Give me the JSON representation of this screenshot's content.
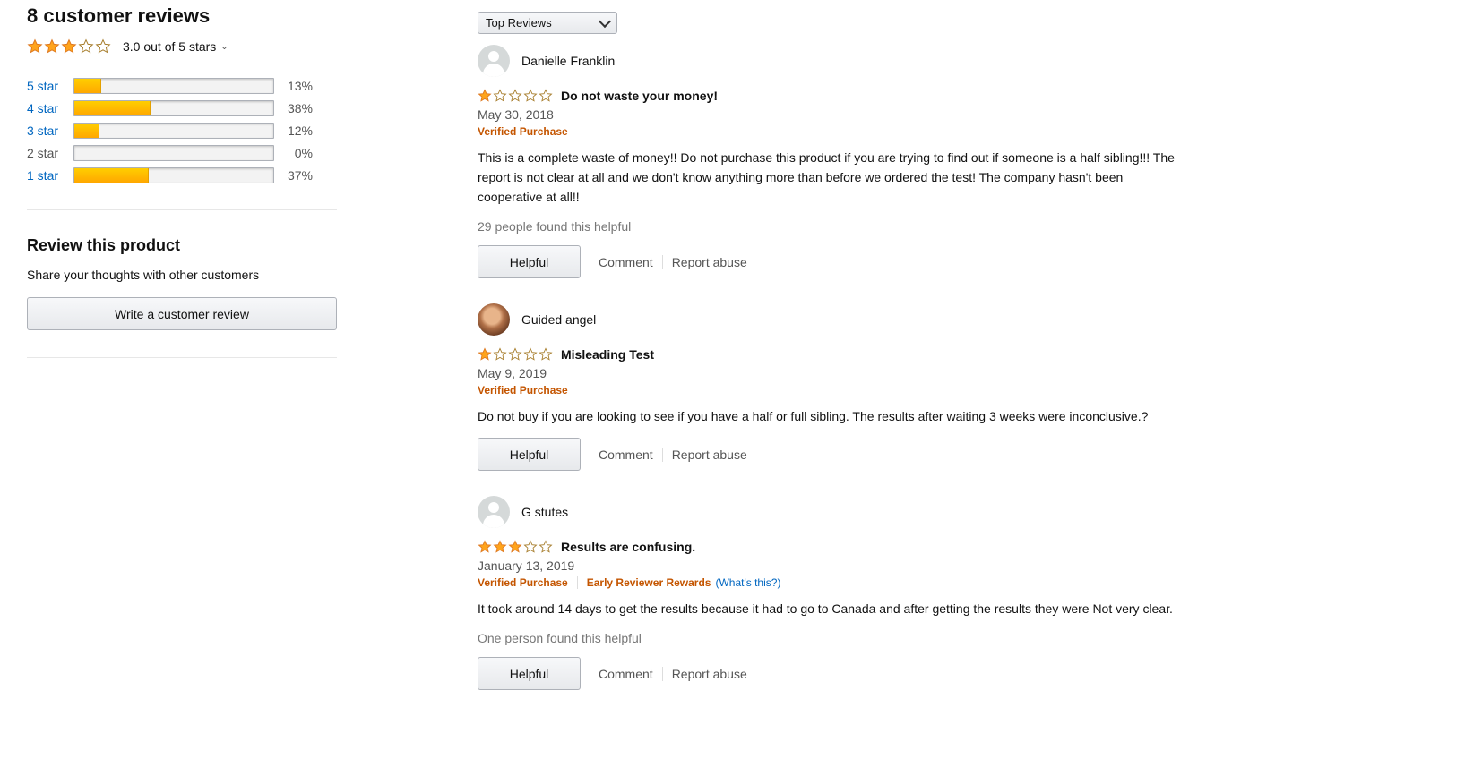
{
  "summary": {
    "title": "8 customer reviews",
    "average_text": "3.0 out of 5 stars",
    "average_stars": 3,
    "histogram": [
      {
        "label": "5 star",
        "percent_text": "13%",
        "percent": 13
      },
      {
        "label": "4 star",
        "percent_text": "38%",
        "percent": 38
      },
      {
        "label": "3 star",
        "percent_text": "12%",
        "percent": 12
      },
      {
        "label": "2 star",
        "percent_text": "0%",
        "percent": 0
      },
      {
        "label": "1 star",
        "percent_text": "37%",
        "percent": 37
      }
    ],
    "review_title": "Review this product",
    "share_text": "Share your thoughts with other customers",
    "write_button": "Write a customer review"
  },
  "sort": {
    "selected": "Top Reviews"
  },
  "reviews": [
    {
      "name": "Danielle Franklin",
      "stars": 1,
      "title": "Do not waste your money!",
      "date": "May 30, 2018",
      "verified": "Verified Purchase",
      "body": "This is a complete waste of money!! Do not purchase this product if you are trying to find out if someone is a half sibling!!! The report is not clear at all and we don't know anything more than before we ordered the test! The company hasn't been cooperative at all!!",
      "helpful_count": "29 people found this helpful"
    },
    {
      "name": "Guided angel",
      "stars": 1,
      "title": "Misleading Test",
      "date": "May 9, 2019",
      "verified": "Verified Purchase",
      "body": "Do not buy if you are looking to see if you have a half or full sibling. The results after waiting 3 weeks were inconclusive.?"
    },
    {
      "name": "G stutes",
      "stars": 3,
      "title": "Results are confusing.",
      "date": "January 13, 2019",
      "verified": "Verified Purchase",
      "early_reviewer": "Early Reviewer Rewards",
      "whats_this": "(What's this?)",
      "body": "It took around 14 days to get the results because it had to go to Canada and after getting the results they were Not very clear.",
      "helpful_count": "One person found this helpful"
    }
  ],
  "actions": {
    "helpful": "Helpful",
    "comment": "Comment",
    "report": "Report abuse"
  },
  "colors": {
    "star": "#ffa41c",
    "link": "#0066c0",
    "badge": "#c45500"
  }
}
